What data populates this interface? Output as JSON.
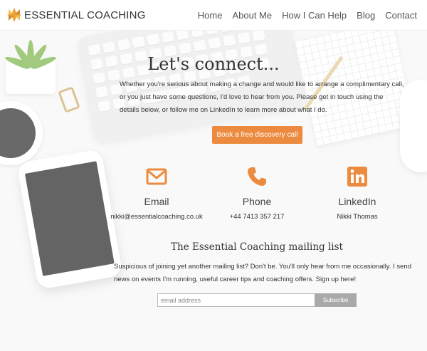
{
  "brand": {
    "name": "ESSENTIAL COACHING",
    "accent_color": "#ec8b3f"
  },
  "nav": {
    "items": [
      "Home",
      "About Me",
      "How I Can Help",
      "Blog",
      "Contact"
    ]
  },
  "connect": {
    "title": "Let's connect...",
    "intro": "Whether you're serious about making a change and would like to arrange a complimentary call, or you just have some questions, I'd love to hear from you. Please get in touch using the details below, or follow me on LinkedIn to learn more about what I do.",
    "cta_label": "Book a free discovery call"
  },
  "contacts": [
    {
      "icon": "envelope-icon",
      "label": "Email",
      "value": "nikki@essentialcoaching.co.uk"
    },
    {
      "icon": "phone-icon",
      "label": "Phone",
      "value": "+44 7413 357 217"
    },
    {
      "icon": "linkedin-icon",
      "label": "LinkedIn",
      "value": "Nikki Thomas"
    }
  ],
  "mailing_list": {
    "title": "The Essential Coaching mailing list",
    "text": "Suspicious of joining yet another mailing list? Don't be. You'll only hear from me occasionally. I send news on events I'm running, useful career tips and coaching offers. Sign up here!",
    "email_placeholder": "email address",
    "email_value": "",
    "subscribe_label": "Subscribe",
    "subscribe_color": "#a9a9a9"
  }
}
